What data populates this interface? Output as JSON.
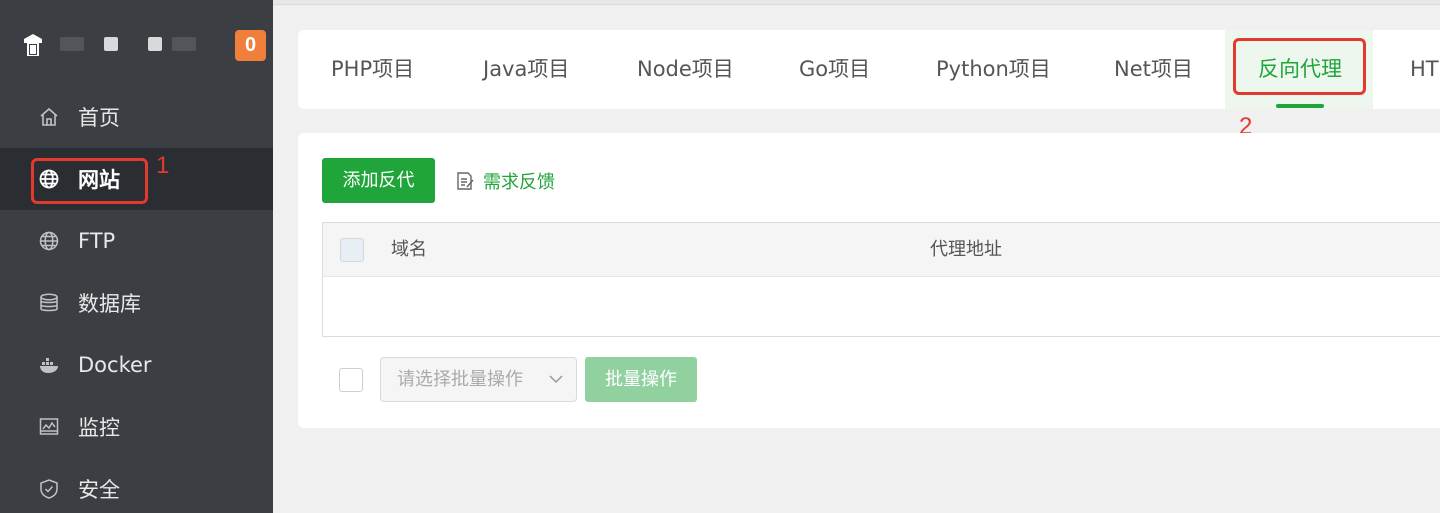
{
  "sidebar": {
    "badge": "0",
    "items": [
      {
        "label": "首页",
        "icon": "home-icon"
      },
      {
        "label": "网站",
        "icon": "globe-icon",
        "active": true
      },
      {
        "label": "FTP",
        "icon": "ftp-icon"
      },
      {
        "label": "数据库",
        "icon": "database-icon"
      },
      {
        "label": "Docker",
        "icon": "docker-icon"
      },
      {
        "label": "监控",
        "icon": "monitor-icon"
      },
      {
        "label": "安全",
        "icon": "shield-icon"
      }
    ]
  },
  "annotations": {
    "num1": "1",
    "num2": "2",
    "color": "#e23a2e"
  },
  "tabs": [
    {
      "label": "PHP项目"
    },
    {
      "label": "Java项目"
    },
    {
      "label": "Node项目"
    },
    {
      "label": "Go项目"
    },
    {
      "label": "Python项目"
    },
    {
      "label": "Net项目"
    },
    {
      "label": "反向代理",
      "active": true
    },
    {
      "label": "HT"
    }
  ],
  "toolbar": {
    "add_label": "添加反代",
    "feedback_label": "需求反馈"
  },
  "table": {
    "columns": [
      "域名",
      "代理地址"
    ]
  },
  "batch": {
    "placeholder": "请选择批量操作",
    "button_label": "批量操作"
  },
  "colors": {
    "accent": "#20a53a",
    "sidebar": "#3b3f44",
    "badge": "#f07f3c"
  }
}
